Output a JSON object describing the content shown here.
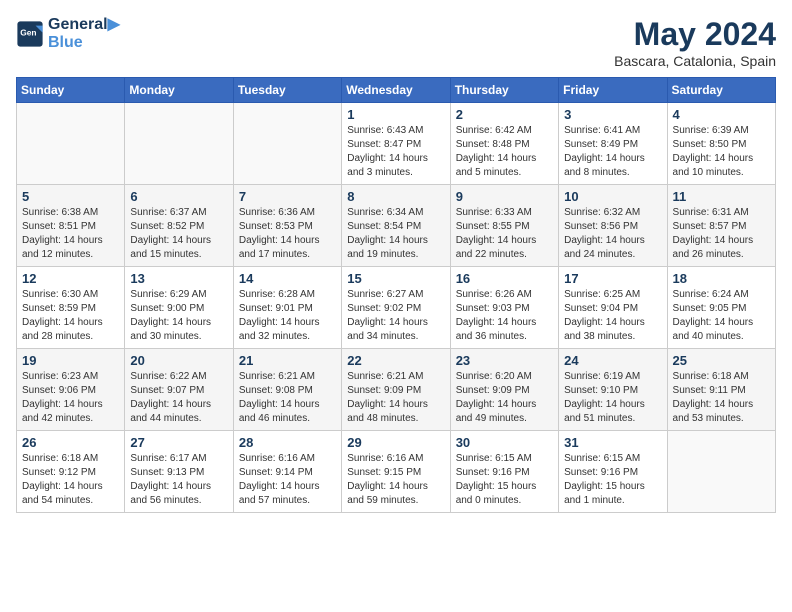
{
  "header": {
    "logo_line1": "General",
    "logo_line2": "Blue",
    "month_title": "May 2024",
    "location": "Bascara, Catalonia, Spain"
  },
  "weekdays": [
    "Sunday",
    "Monday",
    "Tuesday",
    "Wednesday",
    "Thursday",
    "Friday",
    "Saturday"
  ],
  "weeks": [
    [
      {
        "day": "",
        "info": ""
      },
      {
        "day": "",
        "info": ""
      },
      {
        "day": "",
        "info": ""
      },
      {
        "day": "1",
        "info": "Sunrise: 6:43 AM\nSunset: 8:47 PM\nDaylight: 14 hours\nand 3 minutes."
      },
      {
        "day": "2",
        "info": "Sunrise: 6:42 AM\nSunset: 8:48 PM\nDaylight: 14 hours\nand 5 minutes."
      },
      {
        "day": "3",
        "info": "Sunrise: 6:41 AM\nSunset: 8:49 PM\nDaylight: 14 hours\nand 8 minutes."
      },
      {
        "day": "4",
        "info": "Sunrise: 6:39 AM\nSunset: 8:50 PM\nDaylight: 14 hours\nand 10 minutes."
      }
    ],
    [
      {
        "day": "5",
        "info": "Sunrise: 6:38 AM\nSunset: 8:51 PM\nDaylight: 14 hours\nand 12 minutes."
      },
      {
        "day": "6",
        "info": "Sunrise: 6:37 AM\nSunset: 8:52 PM\nDaylight: 14 hours\nand 15 minutes."
      },
      {
        "day": "7",
        "info": "Sunrise: 6:36 AM\nSunset: 8:53 PM\nDaylight: 14 hours\nand 17 minutes."
      },
      {
        "day": "8",
        "info": "Sunrise: 6:34 AM\nSunset: 8:54 PM\nDaylight: 14 hours\nand 19 minutes."
      },
      {
        "day": "9",
        "info": "Sunrise: 6:33 AM\nSunset: 8:55 PM\nDaylight: 14 hours\nand 22 minutes."
      },
      {
        "day": "10",
        "info": "Sunrise: 6:32 AM\nSunset: 8:56 PM\nDaylight: 14 hours\nand 24 minutes."
      },
      {
        "day": "11",
        "info": "Sunrise: 6:31 AM\nSunset: 8:57 PM\nDaylight: 14 hours\nand 26 minutes."
      }
    ],
    [
      {
        "day": "12",
        "info": "Sunrise: 6:30 AM\nSunset: 8:59 PM\nDaylight: 14 hours\nand 28 minutes."
      },
      {
        "day": "13",
        "info": "Sunrise: 6:29 AM\nSunset: 9:00 PM\nDaylight: 14 hours\nand 30 minutes."
      },
      {
        "day": "14",
        "info": "Sunrise: 6:28 AM\nSunset: 9:01 PM\nDaylight: 14 hours\nand 32 minutes."
      },
      {
        "day": "15",
        "info": "Sunrise: 6:27 AM\nSunset: 9:02 PM\nDaylight: 14 hours\nand 34 minutes."
      },
      {
        "day": "16",
        "info": "Sunrise: 6:26 AM\nSunset: 9:03 PM\nDaylight: 14 hours\nand 36 minutes."
      },
      {
        "day": "17",
        "info": "Sunrise: 6:25 AM\nSunset: 9:04 PM\nDaylight: 14 hours\nand 38 minutes."
      },
      {
        "day": "18",
        "info": "Sunrise: 6:24 AM\nSunset: 9:05 PM\nDaylight: 14 hours\nand 40 minutes."
      }
    ],
    [
      {
        "day": "19",
        "info": "Sunrise: 6:23 AM\nSunset: 9:06 PM\nDaylight: 14 hours\nand 42 minutes."
      },
      {
        "day": "20",
        "info": "Sunrise: 6:22 AM\nSunset: 9:07 PM\nDaylight: 14 hours\nand 44 minutes."
      },
      {
        "day": "21",
        "info": "Sunrise: 6:21 AM\nSunset: 9:08 PM\nDaylight: 14 hours\nand 46 minutes."
      },
      {
        "day": "22",
        "info": "Sunrise: 6:21 AM\nSunset: 9:09 PM\nDaylight: 14 hours\nand 48 minutes."
      },
      {
        "day": "23",
        "info": "Sunrise: 6:20 AM\nSunset: 9:09 PM\nDaylight: 14 hours\nand 49 minutes."
      },
      {
        "day": "24",
        "info": "Sunrise: 6:19 AM\nSunset: 9:10 PM\nDaylight: 14 hours\nand 51 minutes."
      },
      {
        "day": "25",
        "info": "Sunrise: 6:18 AM\nSunset: 9:11 PM\nDaylight: 14 hours\nand 53 minutes."
      }
    ],
    [
      {
        "day": "26",
        "info": "Sunrise: 6:18 AM\nSunset: 9:12 PM\nDaylight: 14 hours\nand 54 minutes."
      },
      {
        "day": "27",
        "info": "Sunrise: 6:17 AM\nSunset: 9:13 PM\nDaylight: 14 hours\nand 56 minutes."
      },
      {
        "day": "28",
        "info": "Sunrise: 6:16 AM\nSunset: 9:14 PM\nDaylight: 14 hours\nand 57 minutes."
      },
      {
        "day": "29",
        "info": "Sunrise: 6:16 AM\nSunset: 9:15 PM\nDaylight: 14 hours\nand 59 minutes."
      },
      {
        "day": "30",
        "info": "Sunrise: 6:15 AM\nSunset: 9:16 PM\nDaylight: 15 hours\nand 0 minutes."
      },
      {
        "day": "31",
        "info": "Sunrise: 6:15 AM\nSunset: 9:16 PM\nDaylight: 15 hours\nand 1 minute."
      },
      {
        "day": "",
        "info": ""
      }
    ]
  ]
}
